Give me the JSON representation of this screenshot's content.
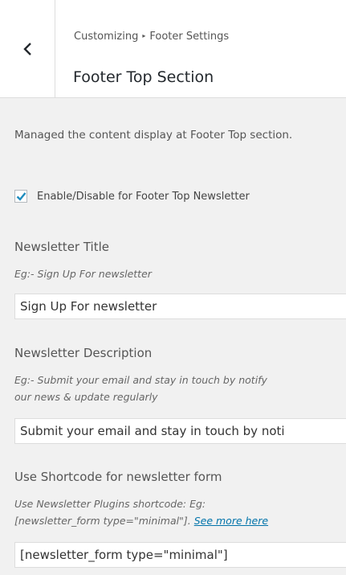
{
  "header": {
    "breadcrumb_root": "Customizing",
    "breadcrumb_parent": "Footer Settings",
    "section_title": "Footer Top Section"
  },
  "intro": {
    "description": "Managed the content display at Footer Top section."
  },
  "newsletter_toggle": {
    "label": "Enable/Disable for Footer Top Newsletter",
    "checked": true
  },
  "fields": {
    "title": {
      "label": "Newsletter Title",
      "hint": "Eg:- Sign Up For newsletter",
      "value": "Sign Up For newsletter"
    },
    "description": {
      "label": "Newsletter Description",
      "hint_line1": "Eg:- Submit your email and stay in touch by notify",
      "hint_line2": "our news & update regularly",
      "value": "Submit your email and stay in touch by noti"
    },
    "shortcode": {
      "label": "Use Shortcode for newsletter form",
      "hint_line1": "Use Newsletter Plugins shortcode: Eg:",
      "hint_line2": "[newsletter_form type=\"minimal\"].",
      "hint_link": "See more here",
      "value": "[newsletter_form type=\"minimal\"]"
    }
  },
  "colors": {
    "accent": "#0073aa",
    "panel_bg": "#f1f1f1",
    "header_bg": "#ffffff"
  },
  "icons": {
    "back": "chevron-left-icon",
    "breadcrumb_separator": "triangle-right-icon",
    "check": "checkmark-icon"
  }
}
